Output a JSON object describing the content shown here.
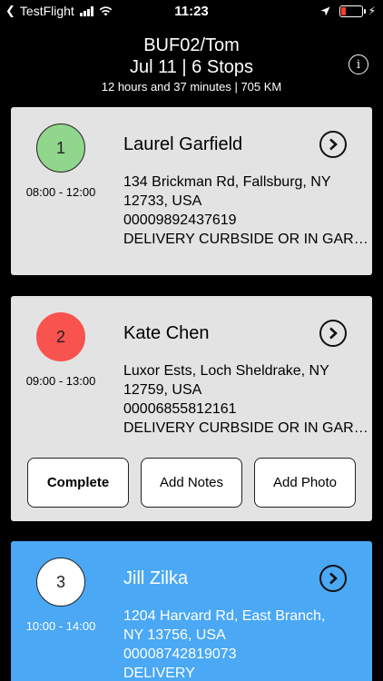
{
  "status_bar": {
    "back_app": "TestFlight",
    "time": "11:23",
    "colors": {
      "battery_low": "#ff3b30"
    }
  },
  "header": {
    "title": "BUF02/Tom",
    "subtitle": "Jul 11 | 6 Stops",
    "meta": "12 hours and 37 minutes | 705 KM",
    "info_label": "i"
  },
  "stops": [
    {
      "number": "1",
      "time_window": "08:00 - 12:00",
      "name": "Laurel Garfield",
      "address_line1": "134 Brickman Rd, Fallsburg, NY",
      "address_line2": "12733, USA",
      "tracking": "00009892437619",
      "note": "DELIVERY CURBSIDE OR IN GARAGE",
      "circle_color": "#90d68c"
    },
    {
      "number": "2",
      "time_window": "09:00 - 13:00",
      "name": "Kate Chen",
      "address_line1": "Luxor Ests, Loch Sheldrake, NY",
      "address_line2": "12759, USA",
      "tracking": "00006855812161",
      "note": "DELIVERY CURBSIDE OR IN GARAGE",
      "circle_color": "#f8534f",
      "actions": {
        "complete": "Complete",
        "add_notes": "Add Notes",
        "add_photo": "Add Photo"
      }
    },
    {
      "number": "3",
      "time_window": "10:00 - 14:00",
      "name": "Jill Zilka",
      "address_line1": "1204 Harvard Rd, East Branch,",
      "address_line2": "NY 13756, USA",
      "tracking": "00008742819073",
      "note": "DELIVERY",
      "circle_color": "#ffffff",
      "card_color": "#4aa8f5"
    }
  ]
}
